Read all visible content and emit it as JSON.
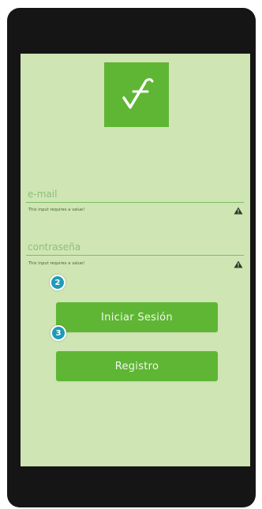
{
  "login": {
    "logo_icon": "f-checkmark-logo-icon",
    "email_placeholder": "e-mail",
    "email_error": "This input requires a value!",
    "password_placeholder": "contraseña",
    "password_error": "This input requires a value!",
    "login_button": "Iniciar Sesión",
    "register_button": "Registro",
    "warning_icon": "warning-triangle-icon"
  },
  "annotations": {
    "badge_login_area": "2",
    "badge_login_button": "3"
  },
  "colors": {
    "screen_bg": "#cfe5b4",
    "accent_green": "#5fb635",
    "badge_blue": "#1e9bb8",
    "device_frame": "#151515"
  }
}
